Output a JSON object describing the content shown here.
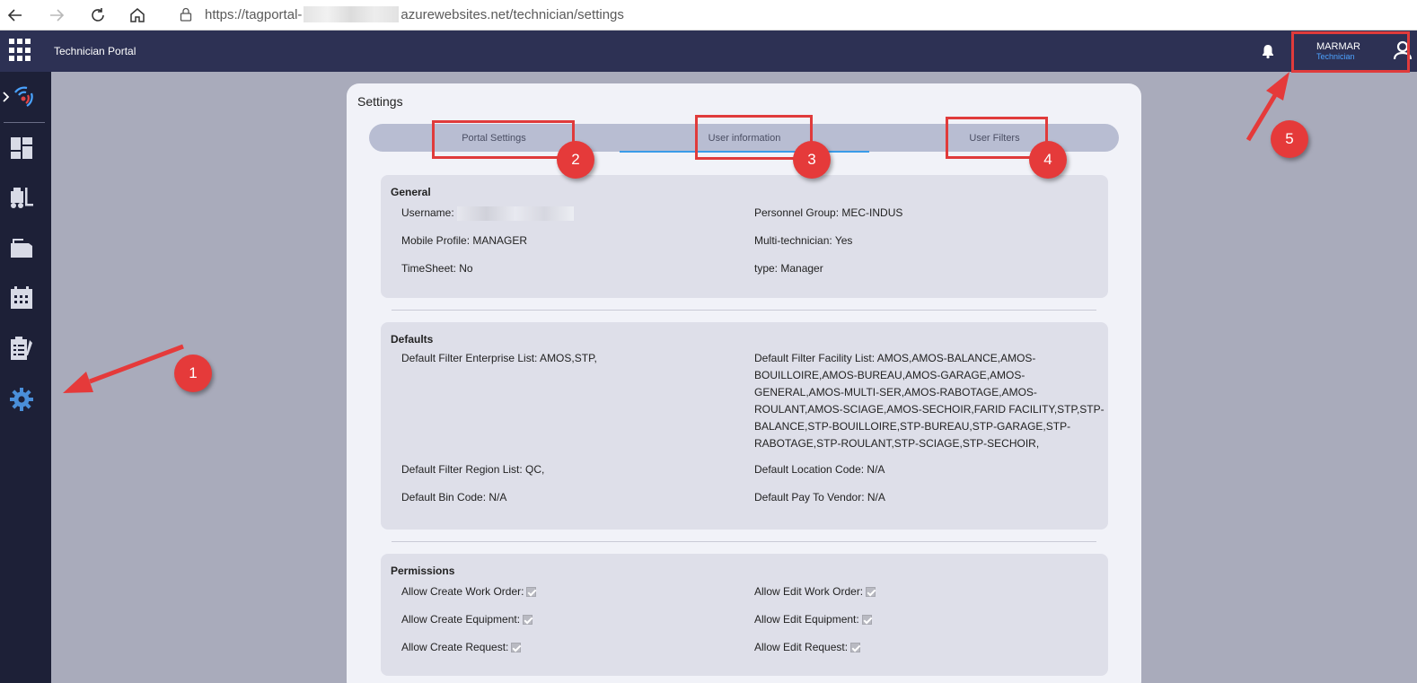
{
  "browser": {
    "url_prefix": "https://tagportal-",
    "url_suffix": "azurewebsites.net/technician/settings"
  },
  "header": {
    "title": "Technician Portal",
    "user_name": "MARMAR",
    "user_role": "Technician"
  },
  "settings": {
    "title": "Settings",
    "tabs": [
      "Portal Settings",
      "User information",
      "User Filters"
    ],
    "active_tab": "User information",
    "general": {
      "title": "General",
      "username_label": "Username:",
      "personnel_group": "Personnel Group: MEC-INDUS",
      "mobile_profile": "Mobile Profile: MANAGER",
      "multi_technician": "Multi-technician: Yes",
      "timesheet": "TimeSheet: No",
      "type": "type: Manager"
    },
    "defaults": {
      "title": "Defaults",
      "enterprise_list": "Default Filter Enterprise List: AMOS,STP,",
      "facility_list_lines": [
        "Default Filter Facility List: AMOS,AMOS-BALANCE,AMOS-",
        "BOUILLOIRE,AMOS-BUREAU,AMOS-GARAGE,AMOS-",
        "GENERAL,AMOS-MULTI-SER,AMOS-RABOTAGE,AMOS-",
        "ROULANT,AMOS-SCIAGE,AMOS-SECHOIR,FARID FACILITY,STP,STP-",
        "BALANCE,STP-BOUILLOIRE,STP-BUREAU,STP-GARAGE,STP-",
        "RABOTAGE,STP-ROULANT,STP-SCIAGE,STP-SECHOIR,"
      ],
      "region_list": "Default Filter Region List: QC,",
      "location_code": "Default Location Code: N/A",
      "bin_code": "Default Bin Code: N/A",
      "pay_to_vendor": "Default Pay To Vendor: N/A"
    },
    "permissions": {
      "title": "Permissions",
      "create_work_order": "Allow Create Work Order:",
      "edit_work_order": "Allow Edit Work Order:",
      "create_equipment": "Allow Create Equipment:",
      "edit_equipment": "Allow Edit Equipment:",
      "create_request": "Allow Create Request:",
      "edit_request": "Allow Edit Request:"
    }
  },
  "annotations": [
    "1",
    "2",
    "3",
    "4",
    "5"
  ],
  "colors": {
    "header_bg": "#2d3154",
    "sidebar_bg": "#1d2037",
    "annotation_red": "#e03b3b",
    "active_tab_underline": "#3a9be8",
    "role_text": "#4da3ff"
  },
  "icons": {
    "sidebar": [
      "expand-chevron-icon",
      "signal-logo-icon",
      "dashboard-icon",
      "forklift-icon",
      "folder-icon",
      "calendar-icon",
      "clipboard-icon",
      "gear-icon"
    ],
    "header": [
      "app-grid-icon",
      "bell-icon",
      "person-icon"
    ],
    "browser": [
      "back-arrow-icon",
      "forward-arrow-icon",
      "refresh-icon",
      "home-icon",
      "lock-icon"
    ]
  }
}
